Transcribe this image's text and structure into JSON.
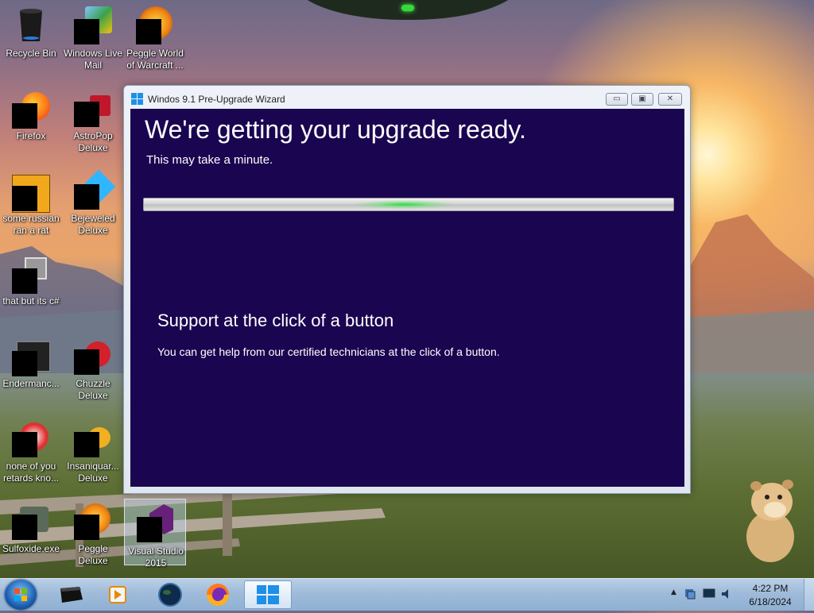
{
  "desktop": {
    "icons": [
      {
        "label": "Recycle Bin",
        "icon": "recycle-bin-icon"
      },
      {
        "label": "Windows Live Mail",
        "icon": "windows-live-mail-icon"
      },
      {
        "label": "Peggle World of Warcraft ...",
        "icon": "peggle-wow-icon"
      },
      {
        "label": "Firefox",
        "icon": "firefox-icon"
      },
      {
        "label": "AstroPop Deluxe",
        "icon": "astropop-icon"
      },
      {
        "label": "some russian ran a rat",
        "icon": "app-icon"
      },
      {
        "label": "Bejeweled Deluxe",
        "icon": "bejeweled-icon"
      },
      {
        "label": "that but its c#",
        "icon": "app-icon"
      },
      {
        "label": "Endermanc...",
        "icon": "app-icon"
      },
      {
        "label": "Chuzzle Deluxe",
        "icon": "chuzzle-icon"
      },
      {
        "label": "none of you retards kno...",
        "icon": "app-icon"
      },
      {
        "label": "Insaniquar... Deluxe",
        "icon": "insaniquarium-icon"
      },
      {
        "label": "Sulfoxide.exe",
        "icon": "app-icon"
      },
      {
        "label": "Peggle Deluxe",
        "icon": "peggle-icon"
      },
      {
        "label": "Visual Studio 2015",
        "icon": "visual-studio-icon"
      }
    ]
  },
  "window": {
    "title": "Windos 9.1 Pre-Upgrade Wizard",
    "minimize": "▭",
    "maximize": "▣",
    "close": "✕",
    "headline": "We're getting your upgrade ready.",
    "subtext": "This may take a minute.",
    "support_title": "Support at the click of a button",
    "support_text": "You can get help from our certified technicians at the click of a button."
  },
  "taskbar": {
    "items": [
      "start-orb",
      "terminal-icon",
      "media-player-icon",
      "earth-icon",
      "firefox-icon",
      "windows-logo-icon"
    ],
    "clock_time": "4:22 PM",
    "clock_date": "6/18/2024",
    "tray_arrow": "▲"
  },
  "colors": {
    "wizard_bg": "#1a0550",
    "progress_glow": "#28dc3c"
  }
}
